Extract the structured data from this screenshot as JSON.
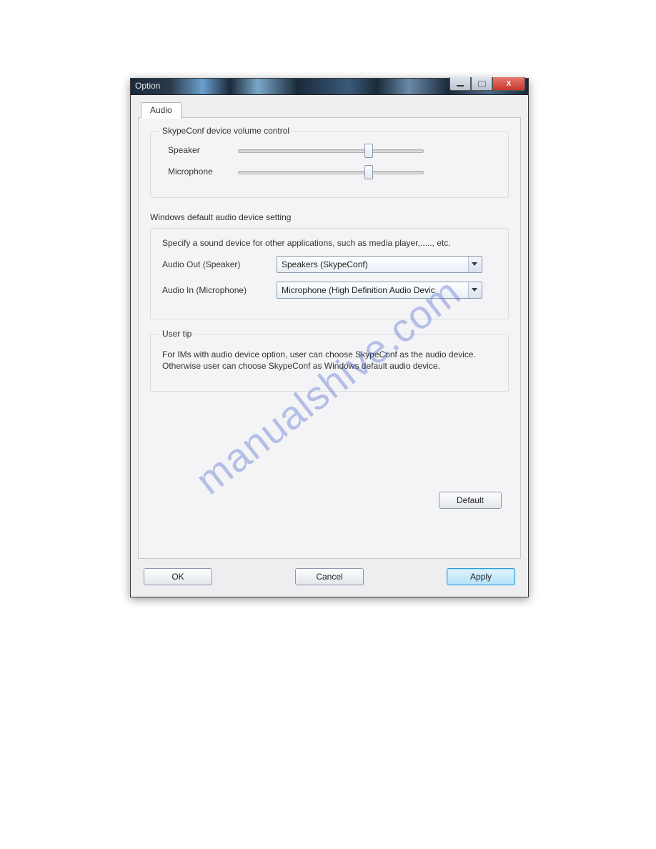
{
  "window": {
    "title": "Option"
  },
  "tab": {
    "audio": "Audio"
  },
  "group_volume": {
    "legend": "SkypeConf device volume control",
    "speaker_label": "Speaker",
    "mic_label": "Microphone",
    "speaker_pos_pct": 68,
    "mic_pos_pct": 68
  },
  "group_default": {
    "heading": "Windows default audio device setting",
    "desc": "Specify a sound device for other applications, such as media player,....., etc.",
    "audio_out_label": "Audio Out (Speaker)",
    "audio_in_label": "Audio In (Microphone)",
    "audio_out_value": "Speakers (SkypeConf)",
    "audio_in_value": "Microphone (High Definition Audio Devic"
  },
  "group_tip": {
    "legend": "User tip",
    "desc": "For IMs with audio device option, user can choose SkypeConf as the audio device. Otherwise user can choose SkypeConf as Windows default audio device."
  },
  "buttons": {
    "default": "Default",
    "ok": "OK",
    "cancel": "Cancel",
    "apply": "Apply"
  },
  "watermark": "manualshive.com"
}
